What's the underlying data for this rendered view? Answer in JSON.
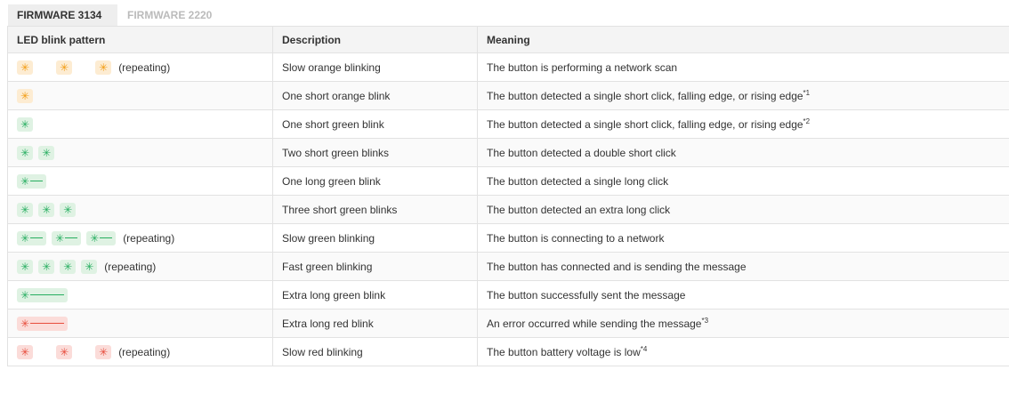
{
  "colors": {
    "orange": "#f39c12",
    "orange_bg": "#fdecd2",
    "green": "#27ae60",
    "green_bg": "#dff2e3",
    "red": "#e74c3c",
    "red_bg": "#fbdcd9"
  },
  "tabs": [
    {
      "label": "FIRMWARE 3134",
      "active": true
    },
    {
      "label": "FIRMWARE 2220",
      "active": false
    }
  ],
  "table": {
    "headers": [
      "LED blink pattern",
      "Description",
      "Meaning"
    ],
    "rows": [
      {
        "pattern": {
          "blinks": [
            {
              "color": "orange",
              "length": "short"
            },
            {
              "color": "orange",
              "length": "short"
            },
            {
              "color": "orange",
              "length": "short"
            }
          ],
          "spaced": true,
          "repeating_label": "(repeating)"
        },
        "description": "Slow orange blinking",
        "meaning": "The button is performing a network scan",
        "footnote": ""
      },
      {
        "pattern": {
          "blinks": [
            {
              "color": "orange",
              "length": "short"
            }
          ],
          "spaced": false,
          "repeating_label": ""
        },
        "description": "One short orange blink",
        "meaning": "The button detected a single short click, falling edge, or rising edge",
        "footnote": "*1"
      },
      {
        "pattern": {
          "blinks": [
            {
              "color": "green",
              "length": "short"
            }
          ],
          "spaced": false,
          "repeating_label": ""
        },
        "description": "One short green blink",
        "meaning": "The button detected a single short click, falling edge, or rising edge",
        "footnote": "*2"
      },
      {
        "pattern": {
          "blinks": [
            {
              "color": "green",
              "length": "short"
            },
            {
              "color": "green",
              "length": "short"
            }
          ],
          "spaced": false,
          "repeating_label": ""
        },
        "description": "Two short green blinks",
        "meaning": "The button detected a double short click",
        "footnote": ""
      },
      {
        "pattern": {
          "blinks": [
            {
              "color": "green",
              "length": "long"
            }
          ],
          "spaced": false,
          "repeating_label": ""
        },
        "description": "One long green blink",
        "meaning": "The button detected a single long click",
        "footnote": ""
      },
      {
        "pattern": {
          "blinks": [
            {
              "color": "green",
              "length": "short"
            },
            {
              "color": "green",
              "length": "short"
            },
            {
              "color": "green",
              "length": "short"
            }
          ],
          "spaced": false,
          "repeating_label": ""
        },
        "description": "Three short green blinks",
        "meaning": "The button detected an extra long click",
        "footnote": ""
      },
      {
        "pattern": {
          "blinks": [
            {
              "color": "green",
              "length": "long"
            },
            {
              "color": "green",
              "length": "long"
            },
            {
              "color": "green",
              "length": "long"
            }
          ],
          "spaced": false,
          "repeating_label": "(repeating)"
        },
        "description": "Slow green blinking",
        "meaning": "The button is connecting to a network",
        "footnote": ""
      },
      {
        "pattern": {
          "blinks": [
            {
              "color": "green",
              "length": "short"
            },
            {
              "color": "green",
              "length": "short"
            },
            {
              "color": "green",
              "length": "short"
            },
            {
              "color": "green",
              "length": "short"
            }
          ],
          "spaced": false,
          "repeating_label": "(repeating)"
        },
        "description": "Fast green blinking",
        "meaning": "The button has connected and is sending the message",
        "footnote": ""
      },
      {
        "pattern": {
          "blinks": [
            {
              "color": "green",
              "length": "extra_long"
            }
          ],
          "spaced": false,
          "repeating_label": ""
        },
        "description": "Extra long green blink",
        "meaning": "The button successfully sent the message",
        "footnote": ""
      },
      {
        "pattern": {
          "blinks": [
            {
              "color": "red",
              "length": "extra_long"
            }
          ],
          "spaced": false,
          "repeating_label": ""
        },
        "description": "Extra long red blink",
        "meaning": "An error occurred while sending the message",
        "footnote": "*3"
      },
      {
        "pattern": {
          "blinks": [
            {
              "color": "red",
              "length": "short"
            },
            {
              "color": "red",
              "length": "short"
            },
            {
              "color": "red",
              "length": "short"
            }
          ],
          "spaced": true,
          "repeating_label": "(repeating)"
        },
        "description": "Slow red blinking",
        "meaning": "The button battery voltage is low",
        "footnote": "*4"
      }
    ]
  }
}
